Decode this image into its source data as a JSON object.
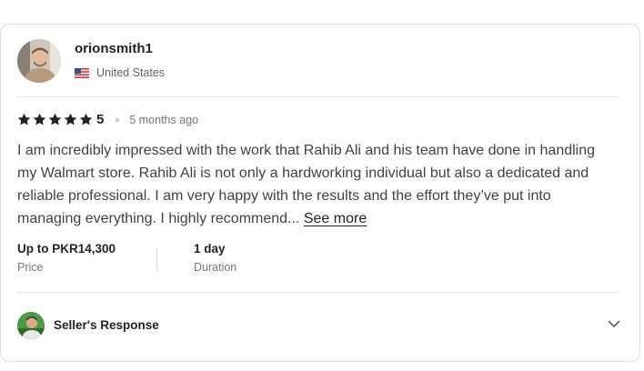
{
  "review": {
    "username": "orionsmith1",
    "country": "United States",
    "rating": "5",
    "rating_value": 5,
    "time_ago": "5 months ago",
    "text": "I am incredibly impressed with the work that Rahib Ali and his team have done in handling my Walmart store. Rahib Ali is not only a hardworking individual but also a dedicated and reliable professional. I am very happy with the results and the effort they’ve put into managing everything. I highly recommend...",
    "see_more": "See more"
  },
  "meta": {
    "price_value": "Up to PKR14,300",
    "price_label": "Price",
    "duration_value": "1 day",
    "duration_label": "Duration"
  },
  "seller": {
    "response_label": "Seller's Response"
  },
  "icons": {
    "star": "star-icon",
    "flag": "us-flag-icon",
    "chevron": "chevron-down-icon"
  },
  "colors": {
    "star": "#222325",
    "text": "#404145",
    "muted": "#74767e"
  }
}
